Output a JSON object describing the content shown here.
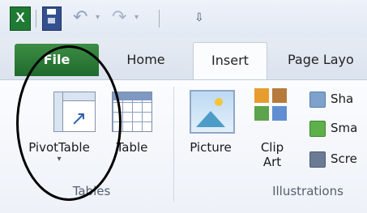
{
  "qat": {
    "app_icon_letter": "X",
    "undo_caret": "▾",
    "redo_caret": "▾"
  },
  "tabs": [
    {
      "label": "File"
    },
    {
      "label": "Home"
    },
    {
      "label": "Insert"
    },
    {
      "label": "Page Layo"
    }
  ],
  "groups": {
    "tables": {
      "label": "Tables",
      "commands": [
        {
          "label": "PivotTable",
          "caret": "▾"
        },
        {
          "label": "Table"
        }
      ]
    },
    "illustrations": {
      "label": "Illustrations",
      "commands": [
        {
          "label": "Picture"
        },
        {
          "label_line1": "Clip",
          "label_line2": "Art"
        },
        {
          "label": "Sha"
        },
        {
          "label": "Sma"
        },
        {
          "label": "Scre"
        }
      ]
    }
  },
  "colors": {
    "file_tab": "#2e7d32",
    "highlight": "#000000",
    "ribbon_bg": "#f7f9fc"
  }
}
